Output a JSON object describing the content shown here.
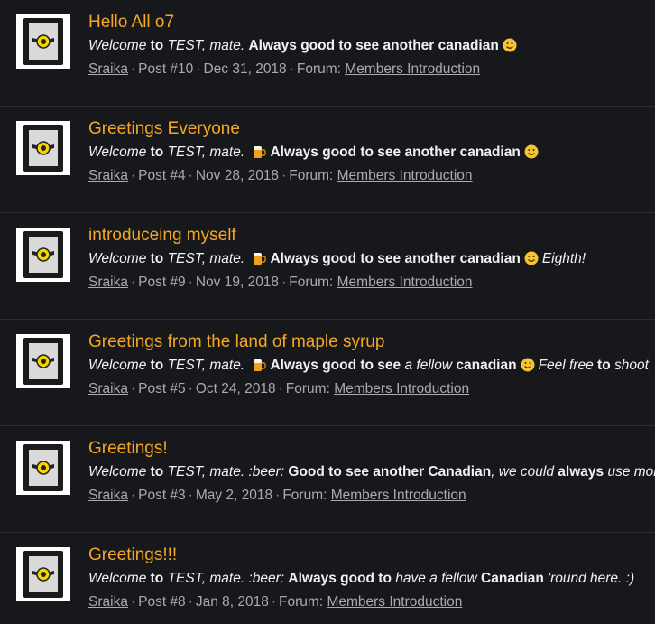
{
  "results": [
    {
      "title": "Hello All o7",
      "snippet": [
        {
          "t": "Welcome",
          "s": "em"
        },
        {
          "t": " to ",
          "s": "b"
        },
        {
          "t": "TEST, mate",
          "s": "em"
        },
        {
          "t": ". ",
          "s": "em"
        },
        {
          "t": "Always good to see another canadian",
          "s": "b"
        },
        {
          "emoji": "smile-emoji"
        }
      ],
      "author": "Sraika",
      "post": "Post #10",
      "date": "Dec 31, 2018",
      "forum_label": "Forum:",
      "forum": "Members Introduction"
    },
    {
      "title": "Greetings Everyone",
      "snippet": [
        {
          "t": "Welcome",
          "s": "em"
        },
        {
          "t": " to ",
          "s": "b"
        },
        {
          "t": "TEST, mate",
          "s": "em"
        },
        {
          "t": ". ",
          "s": "em"
        },
        {
          "emoji": "beer-emoji"
        },
        {
          "t": "Always good to see another canadian",
          "s": "b"
        },
        {
          "emoji": "smile-emoji"
        }
      ],
      "author": "Sraika",
      "post": "Post #4",
      "date": "Nov 28, 2018",
      "forum_label": "Forum:",
      "forum": "Members Introduction"
    },
    {
      "title": "introduceing myself",
      "snippet": [
        {
          "t": "Welcome",
          "s": "em"
        },
        {
          "t": " to ",
          "s": "b"
        },
        {
          "t": "TEST, mate",
          "s": "em"
        },
        {
          "t": ". ",
          "s": "em"
        },
        {
          "emoji": "beer-emoji"
        },
        {
          "t": "Always good to see another canadian",
          "s": "b"
        },
        {
          "emoji": "smile-emoji"
        },
        {
          "t": "Eighth!",
          "s": "em"
        }
      ],
      "author": "Sraika",
      "post": "Post #9",
      "date": "Nov 19, 2018",
      "forum_label": "Forum:",
      "forum": "Members Introduction"
    },
    {
      "title": "Greetings from the land of maple syrup",
      "snippet": [
        {
          "t": "Welcome",
          "s": "em"
        },
        {
          "t": " to ",
          "s": "b"
        },
        {
          "t": "TEST, mate",
          "s": "em"
        },
        {
          "t": ". ",
          "s": "em"
        },
        {
          "emoji": "beer-emoji"
        },
        {
          "t": "Always good to see ",
          "s": "b"
        },
        {
          "t": "a fellow ",
          "s": "em"
        },
        {
          "t": "canadian",
          "s": "b"
        },
        {
          "emoji": "smile-emoji"
        },
        {
          "t": "Feel free",
          "s": "em"
        },
        {
          "t": " to ",
          "s": "b"
        },
        {
          "t": "shoot",
          "s": "em"
        }
      ],
      "author": "Sraika",
      "post": "Post #5",
      "date": "Oct 24, 2018",
      "forum_label": "Forum:",
      "forum": "Members Introduction"
    },
    {
      "title": "Greetings!",
      "snippet": [
        {
          "t": "Welcome",
          "s": "em"
        },
        {
          "t": " to ",
          "s": "b"
        },
        {
          "t": "TEST, mate",
          "s": "em"
        },
        {
          "t": ". :beer: ",
          "s": "em"
        },
        {
          "t": "Good to see another Canadian",
          "s": "b"
        },
        {
          "t": ", we could ",
          "s": "em"
        },
        {
          "t": "always",
          "s": "b"
        },
        {
          "t": " use more",
          "s": "em"
        }
      ],
      "author": "Sraika",
      "post": "Post #3",
      "date": "May 2, 2018",
      "forum_label": "Forum:",
      "forum": "Members Introduction"
    },
    {
      "title": "Greetings!!!",
      "snippet": [
        {
          "t": "Welcome",
          "s": "em"
        },
        {
          "t": " to ",
          "s": "b"
        },
        {
          "t": "TEST, mate",
          "s": "em"
        },
        {
          "t": ". :beer: ",
          "s": "em"
        },
        {
          "t": "Always good to",
          "s": "b"
        },
        {
          "t": " have a fellow ",
          "s": "em"
        },
        {
          "t": "Canadian",
          "s": "b"
        },
        {
          "t": " 'round here. :)",
          "s": "em"
        }
      ],
      "author": "Sraika",
      "post": "Post #8",
      "date": "Jan 8, 2018",
      "forum_label": "Forum:",
      "forum": "Members Introduction"
    }
  ]
}
